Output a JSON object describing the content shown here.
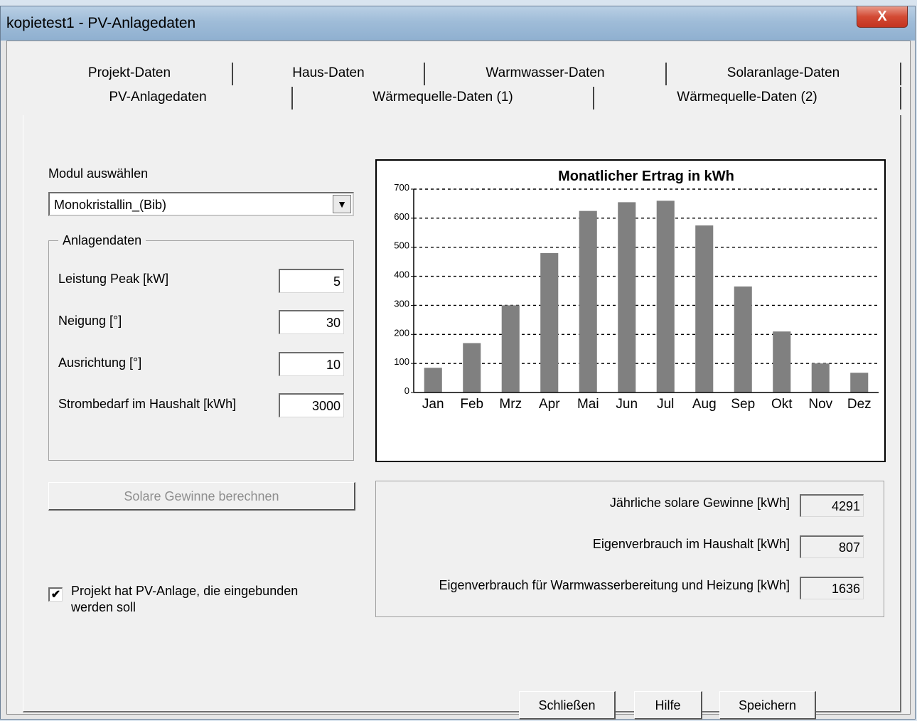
{
  "window": {
    "title": "kopietest1 - PV-Anlagedaten",
    "close_glyph": "X"
  },
  "tabs": {
    "row1": [
      "Projekt-Daten",
      "Haus-Daten",
      "Warmwasser-Daten",
      "Solaranlage-Daten"
    ],
    "row2": [
      "PV-Anlagedaten",
      "Wärmequelle-Daten (1)",
      "Wärmequelle-Daten (2)"
    ],
    "active": "PV-Anlagedaten"
  },
  "module": {
    "label": "Modul auswählen",
    "selected": "Monokristallin_(Bib)"
  },
  "anlagendaten": {
    "legend": "Anlagendaten",
    "fields": [
      {
        "label": "Leistung Peak [kW]",
        "value": "5"
      },
      {
        "label": "Neigung [°]",
        "value": "30"
      },
      {
        "label": "Ausrichtung [°]",
        "value": "10"
      },
      {
        "label": "Strombedarf im Haushalt [kWh]",
        "value": "3000"
      }
    ]
  },
  "calc_button": "Solare Gewinne berechnen",
  "checkbox": {
    "checked": true,
    "line1": "Projekt hat PV-Anlage, die eingebunden",
    "line2": "werden soll"
  },
  "results": [
    {
      "label": "Jährliche solare Gewinne [kWh]",
      "value": "4291"
    },
    {
      "label": "Eigenverbrauch im Haushalt [kWh]",
      "value": "807"
    },
    {
      "label": "Eigenverbrauch für Warmwasserbereitung und Heizung [kWh]",
      "value": "1636"
    }
  ],
  "buttons": {
    "close": "Schließen",
    "help": "Hilfe",
    "save": "Speichern"
  },
  "chart_data": {
    "type": "bar",
    "title": "Monatlicher Ertrag in kWh",
    "categories": [
      "Jan",
      "Feb",
      "Mrz",
      "Apr",
      "Mai",
      "Jun",
      "Jul",
      "Aug",
      "Sep",
      "Okt",
      "Nov",
      "Dez"
    ],
    "values": [
      85,
      170,
      300,
      480,
      625,
      655,
      660,
      575,
      365,
      210,
      100,
      68
    ],
    "ylim": [
      0,
      700
    ],
    "yticks": [
      0,
      100,
      200,
      300,
      400,
      500,
      600,
      700
    ],
    "grid": "dashed horizontal",
    "bar_color": "#808080"
  }
}
